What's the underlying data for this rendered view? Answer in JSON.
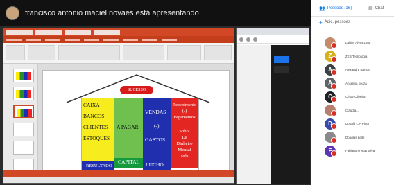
{
  "presenter": {
    "text": "francisco antonio maciel novaes está apresentando"
  },
  "slide": {
    "pill_text": "SUCESSO",
    "yellow": [
      "CAIXA",
      "BANCOS",
      "CLIENTES",
      "ESTOQUES"
    ],
    "base_left": "RESULTADO",
    "green_top": "A PAGAR",
    "base_mid": "CAPITAL",
    "lucro": "LUCRO",
    "blue": [
      "VENDAS",
      "(-)",
      "GASTOS"
    ],
    "base_right": "LUCHO",
    "red": [
      "Recebimento",
      "(-)",
      "Pagamentos",
      "",
      "Sobra",
      "De",
      "Dinheiro",
      "Mensal",
      "Mês"
    ]
  },
  "panel": {
    "tab_people": "Pessoas (16)",
    "tab_chat": "Chat",
    "add_people": "Adic. pessoas",
    "participants": [
      {
        "name": "Lahiny Alves Lima",
        "initial": "",
        "color": "#c58a6a"
      },
      {
        "name": "ZEB Tecnologia",
        "initial": "Z",
        "color": "#d6b11e"
      },
      {
        "name": "Alexandre Barros",
        "initial": "A",
        "color": "#3c4043"
      },
      {
        "name": "Anselma souza",
        "initial": "A",
        "color": "#5f6368"
      },
      {
        "name": "César Oliveira",
        "initial": "C",
        "color": "#202124"
      },
      {
        "name": "Cláudia...",
        "initial": "",
        "color": "#b77d6d"
      },
      {
        "name": "Donald C A Pinto",
        "initial": "D",
        "color": "#3949ab"
      },
      {
        "name": "Douglas Leite",
        "initial": "",
        "color": "#8a8a8a"
      },
      {
        "name": "Fabiano Freitas Silva",
        "initial": "F",
        "color": "#5e35b1"
      }
    ]
  }
}
